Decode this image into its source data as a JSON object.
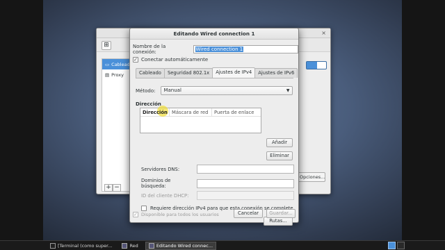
{
  "background_window": {
    "sidebar_items": [
      {
        "label": "Cableado",
        "icon": "wired-network-icon"
      },
      {
        "label": "Proxy",
        "icon": "proxy-icon"
      }
    ],
    "add_label": "+",
    "remove_label": "−",
    "options_button": "Opciones...",
    "close_glyph": "×"
  },
  "dialog": {
    "title": "Editando Wired connection 1",
    "connection_name_label": "Nombre de la conexión:",
    "connection_name_value": "Wired connection 1",
    "autoconnect_label": "Conectar automáticamente",
    "autoconnect_checked": true,
    "tabs": [
      {
        "label": "Cableado",
        "active": false
      },
      {
        "label": "Seguridad 802.1x",
        "active": false
      },
      {
        "label": "Ajustes de IPv4",
        "active": true
      },
      {
        "label": "Ajustes de IPv6",
        "active": false
      }
    ],
    "method_label": "Método:",
    "method_value": "Manual",
    "addresses_title": "Dirección",
    "addresses_columns": [
      "Dirección",
      "Máscara de red",
      "Puerta de enlace"
    ],
    "add_button": "Añadir",
    "delete_button": "Eliminar",
    "dns_label": "Servidores DNS:",
    "search_domains_label": "Dominios de búsqueda:",
    "dhcp_client_label": "ID del cliente DHCP:",
    "require_ipv4_label": "Requiere dirección IPv4 para que esta conexión se complete",
    "routes_button": "Rutas...",
    "shared_label": "Disponible para todos los usuarios",
    "cancel_button": "Cancelar",
    "save_button": "Guardar..."
  },
  "taskbar": {
    "items": [
      {
        "label": "[Terminal (como super...",
        "icon": "terminal-icon",
        "active": false
      },
      {
        "label": "Red",
        "icon": "network-icon",
        "active": false
      },
      {
        "label": "Editando Wired connec...",
        "icon": "network-icon",
        "active": true
      }
    ]
  },
  "colors": {
    "accent": "#4a90d9",
    "desktop": "#4a5d7c",
    "highlight": "#f0dc28"
  }
}
